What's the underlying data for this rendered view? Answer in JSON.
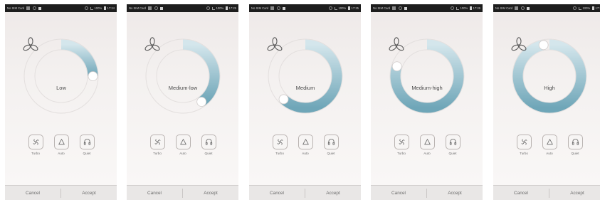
{
  "statusbar": {
    "carrier": "No SIM Card",
    "battery": "100%"
  },
  "screens": [
    {
      "time": "17:24",
      "speed": "Low",
      "level": 0.25
    },
    {
      "time": "17:25",
      "speed": "Medium-low",
      "level": 0.4
    },
    {
      "time": "17:25",
      "speed": "Medium",
      "level": 0.62
    },
    {
      "time": "17:26",
      "speed": "Medium-high",
      "level": 0.8
    },
    {
      "time": "17:26",
      "speed": "High",
      "level": 0.97
    }
  ],
  "modes": {
    "turbo": "Turbo",
    "auto": "Auto",
    "quiet": "Quiet"
  },
  "footer": {
    "cancel": "Cancel",
    "accept": "Accept"
  },
  "colors": {
    "accent": "#6fa6b8",
    "track": "#e3dfde",
    "status_bar": "#1d1d1d"
  },
  "icons": {
    "center": "fan-icon",
    "turbo": "turbo-fan-icon",
    "auto": "auto-triangle-icon",
    "quiet": "headphones-icon"
  }
}
